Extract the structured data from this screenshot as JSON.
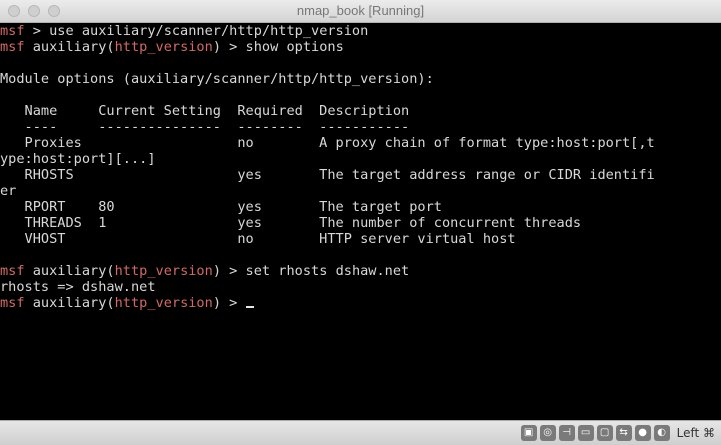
{
  "window": {
    "title": "nmap_book [Running]"
  },
  "terminal": {
    "l1": {
      "prompt": "msf",
      "text": " > use auxiliary/scanner/http/http_version"
    },
    "l2": {
      "prompt": "msf",
      "mid": " auxiliary(",
      "module": "http_version",
      "text": ") > show options"
    },
    "l3": {
      "text": "Module options (auxiliary/scanner/http/http_version):"
    },
    "header": {
      "text": "   Name     Current Setting  Required  Description"
    },
    "underline": {
      "text": "   ----     ---------------  --------  -----------"
    },
    "row1": {
      "text": "   Proxies                   no        A proxy chain of format type:host:port[,t"
    },
    "row1b": {
      "text": "ype:host:port][...]"
    },
    "row2": {
      "text": "   RHOSTS                    yes       The target address range or CIDR identifi"
    },
    "row2b": {
      "text": "er"
    },
    "row3": {
      "text": "   RPORT    80               yes       The target port"
    },
    "row4": {
      "text": "   THREADS  1                yes       The number of concurrent threads"
    },
    "row5": {
      "text": "   VHOST                     no        HTTP server virtual host"
    },
    "l4": {
      "prompt": "msf",
      "mid": " auxiliary(",
      "module": "http_version",
      "text": ") > set rhosts dshaw.net"
    },
    "l5": {
      "text": "rhosts => dshaw.net"
    },
    "l6": {
      "prompt": "msf",
      "mid": " auxiliary(",
      "module": "http_version",
      "text": ") > "
    }
  },
  "statusbar": {
    "icons": [
      "disk-icon",
      "cd-icon",
      "usb-icon",
      "folder-icon",
      "display-icon",
      "network-icon",
      "capture-icon",
      "mouse-icon"
    ],
    "host_key": "Left ⌘"
  }
}
